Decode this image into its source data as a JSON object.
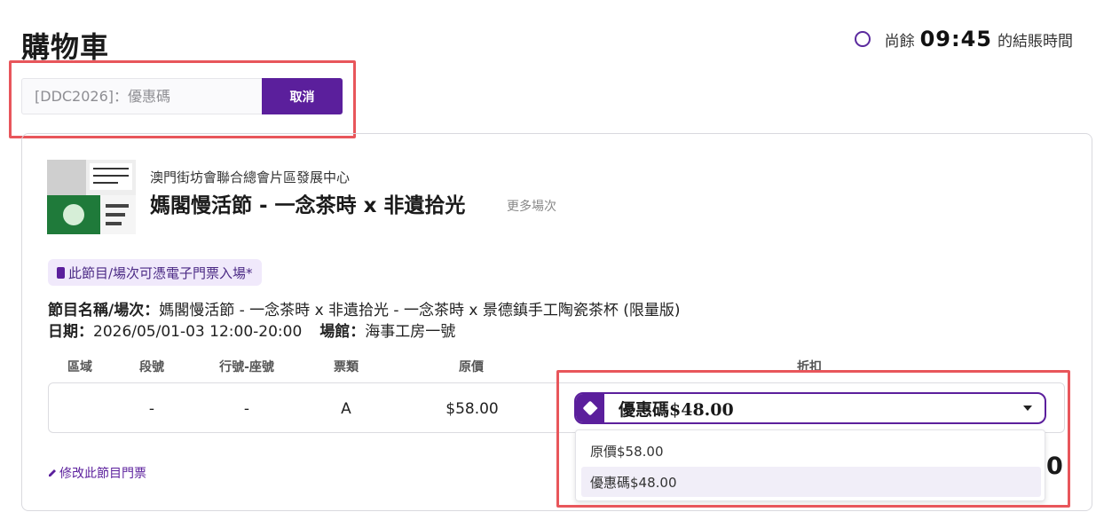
{
  "header": {
    "title": "購物車",
    "timer_prefix": "尚餘",
    "timer_value": "09:45",
    "timer_suffix": "的結賬時間"
  },
  "coupon": {
    "placeholder": "[DDC2026]：優惠碼",
    "cancel_label": "取消"
  },
  "event": {
    "organizer": "澳門街坊會聯合總會片區發展中心",
    "title": "媽閣慢活節 - 一念茶時 x 非遺拾光",
    "more_sessions": "更多場次",
    "eticket_badge": "此節目/場次可憑電子門票入場*",
    "name_label": "節目名稱/場次：",
    "name_value": "媽閣慢活節 - 一念茶時 x 非遺拾光 - 一念茶時 x 景德鎮手工陶瓷茶杯 (限量版)",
    "date_label": "日期：",
    "date_value": "2026/05/01-03 12:00-20:00",
    "venue_label": "場館：",
    "venue_value": "海事工房一號"
  },
  "table": {
    "headers": [
      "區域",
      "段號",
      "行號-座號",
      "票類",
      "原價",
      "折扣"
    ],
    "row": {
      "area": "",
      "section": "-",
      "row_seat": "-",
      "ticket_type": "A",
      "price": "$58.00"
    }
  },
  "discount": {
    "selected": "優惠碼$48.00",
    "options": [
      "原價$58.00",
      "優惠碼$48.00"
    ],
    "highlighted_index": 1
  },
  "footer": {
    "edit_link": "修改此節目門票",
    "total_fragment": "0"
  },
  "colors": {
    "brand_purple": "#5b1f9c",
    "highlight_red": "#e8565b",
    "badge_bg": "#f0e9fb"
  },
  "icons": {
    "timer": "circle-outline-icon",
    "eticket": "phone-icon",
    "discount": "tag-icon",
    "dropdown": "chevron-down-icon",
    "edit": "pencil-icon"
  }
}
